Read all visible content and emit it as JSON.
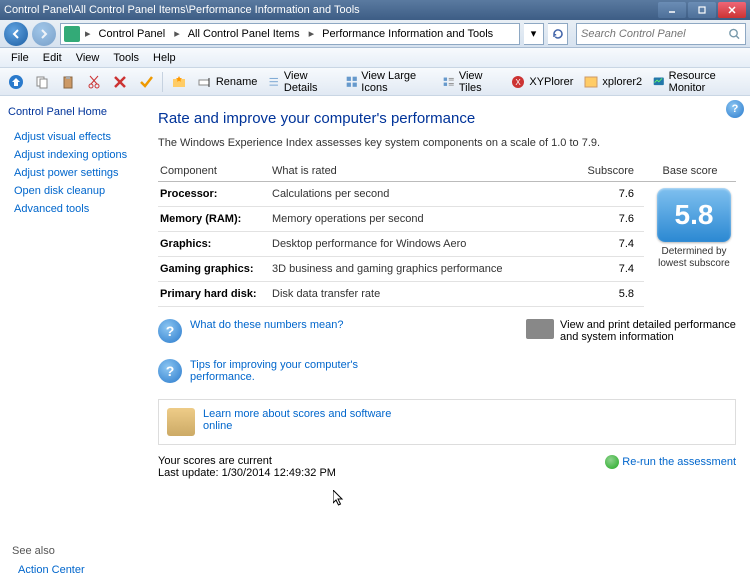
{
  "window": {
    "title": "Control Panel\\All Control Panel Items\\Performance Information and Tools"
  },
  "breadcrumb": {
    "items": [
      "Control Panel",
      "All Control Panel Items",
      "Performance Information and Tools"
    ]
  },
  "search": {
    "placeholder": "Search Control Panel"
  },
  "menubar": [
    "File",
    "Edit",
    "View",
    "Tools",
    "Help"
  ],
  "toolbar": {
    "rename": "Rename",
    "view_details": "View Details",
    "view_large": "View Large Icons",
    "view_tiles": "View Tiles",
    "xyplorer": "XYPlorer",
    "xplorer2": "xplorer2",
    "resmon": "Resource Monitor"
  },
  "sidebar": {
    "home": "Control Panel Home",
    "links": [
      "Adjust visual effects",
      "Adjust indexing options",
      "Adjust power settings",
      "Open disk cleanup",
      "Advanced tools"
    ],
    "seealso_hdr": "See also",
    "seealso_link": "Action Center"
  },
  "content": {
    "heading": "Rate and improve your computer's performance",
    "intro": "The Windows Experience Index assesses key system components on a scale of 1.0 to 7.9.",
    "table": {
      "headers": {
        "component": "Component",
        "rated": "What is rated",
        "subscore": "Subscore",
        "base": "Base score"
      },
      "rows": [
        {
          "comp": "Processor:",
          "rated": "Calculations per second",
          "sub": "7.6"
        },
        {
          "comp": "Memory (RAM):",
          "rated": "Memory operations per second",
          "sub": "7.6"
        },
        {
          "comp": "Graphics:",
          "rated": "Desktop performance for Windows Aero",
          "sub": "7.4"
        },
        {
          "comp": "Gaming graphics:",
          "rated": "3D business and gaming graphics performance",
          "sub": "7.4"
        },
        {
          "comp": "Primary hard disk:",
          "rated": "Disk data transfer rate",
          "sub": "5.8"
        }
      ],
      "base_score": "5.8",
      "base_caption": "Determined by lowest subscore"
    },
    "help_links": {
      "numbers": "What do these numbers mean?",
      "tips": "Tips for improving your computer's performance.",
      "print": "View and print detailed performance and system information",
      "learn": "Learn more about scores and software online"
    },
    "status": {
      "current": "Your scores are current",
      "updated": "Last update: 1/30/2014 12:49:32 PM",
      "rerun": "Re-run the assessment"
    }
  }
}
